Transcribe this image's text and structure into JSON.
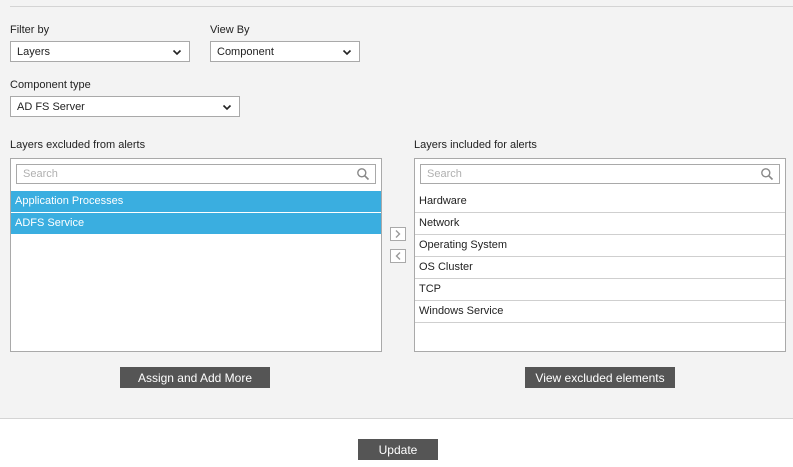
{
  "filter_by": {
    "label": "Filter by",
    "value": "Layers"
  },
  "view_by": {
    "label": "View By",
    "value": "Component"
  },
  "component_type": {
    "label": "Component type",
    "value": "AD FS Server"
  },
  "excluded": {
    "label": "Layers excluded from alerts",
    "search_placeholder": "Search",
    "items": [
      "Application Processes",
      "ADFS Service"
    ]
  },
  "included": {
    "label": "Layers included for alerts",
    "search_placeholder": "Search",
    "items": [
      "Hardware",
      "Network",
      "Operating System",
      "OS Cluster",
      "TCP",
      "Windows Service"
    ]
  },
  "buttons": {
    "assign": "Assign and Add More",
    "view_excluded": "View excluded elements",
    "update": "Update"
  },
  "colors": {
    "selected": "#3aaee0",
    "button": "#555555"
  },
  "icons": {
    "search": "search-icon",
    "dropdown": "chevron-down-icon",
    "move_right": "chevron-right-icon",
    "move_left": "chevron-left-icon"
  }
}
